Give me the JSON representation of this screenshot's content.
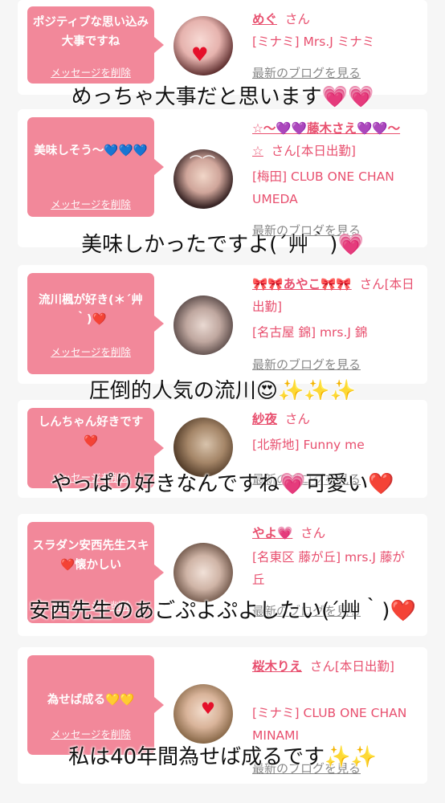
{
  "entries": [
    {
      "bubble_message": "ポジティブな思い込み大事ですね",
      "delete_label": "メッセージを削除",
      "name": "めぐ",
      "honorific": "さん",
      "shop": "[ミナミ] Mrs.J ミナミ",
      "blog_link": "最新のブログを見る",
      "caption": "めっちゃ大事だと思います💗💗"
    },
    {
      "bubble_message": "美味しそう〜💙💙💙",
      "delete_label": "メッセージを削除",
      "name": "☆〜💜💜藤木さえ💜💜〜☆",
      "honorific": "さん[本日出勤]",
      "shop": "[梅田] CLUB ONE CHAN UMEDA",
      "blog_link": "最新のブログを見る",
      "caption": "美味しかったですよ(´艸｀)💗"
    },
    {
      "bubble_message": "流川楓が好き(＊´艸｀)❤️",
      "delete_label": "メッセージを削除",
      "name": "🎀🎀あやこ🎀🎀",
      "honorific": "さん[本日出勤]",
      "shop": "[名古屋 錦] mrs.J 錦",
      "blog_link": "最新のブログを見る",
      "caption": "圧倒的人気の流川😍✨✨✨"
    },
    {
      "bubble_message": "しんちゃん好きです❤️",
      "delete_label": "メッセージを削除",
      "name": "紗夜",
      "honorific": "さん",
      "shop": "[北新地] Funny me",
      "blog_link": "最新のブログを見る",
      "caption": "やっぱり好きなんですね💗可愛い❤️"
    },
    {
      "bubble_message": "スラダン安西先生スキ❤️懐かしい",
      "delete_label": "メッセージを削除",
      "name": "やよ💗",
      "honorific": "さん",
      "shop": "[名東区 藤が丘] mrs.J 藤が丘",
      "blog_link": "最新のブログを見る",
      "caption": "安西先生のあごぷよぷよしたい(´艸｀)❤️"
    },
    {
      "bubble_message": "為せば成る💛💛",
      "delete_label": "メッセージを削除",
      "name": "桜木りえ",
      "honorific": "さん[本日出勤]",
      "shop": "[ミナミ] CLUB ONE CHAN MINAMI",
      "blog_link": "最新のブログを見る",
      "caption": "私は40年間為せば成るです✨✨"
    }
  ],
  "colors": {
    "bubble": "#f2889a",
    "name_text": "#e8506f",
    "link_gray": "#888888",
    "page_bg": "#f6f6f6"
  }
}
